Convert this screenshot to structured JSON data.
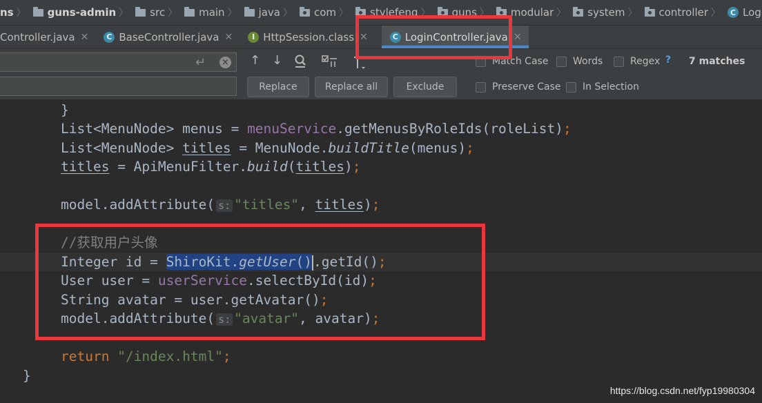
{
  "breadcrumb": {
    "items": [
      {
        "label": "ns",
        "type": "text"
      },
      {
        "label": "guns-admin",
        "type": "module"
      },
      {
        "label": "src",
        "type": "folder"
      },
      {
        "label": "main",
        "type": "folder"
      },
      {
        "label": "java",
        "type": "folder"
      },
      {
        "label": "com",
        "type": "package"
      },
      {
        "label": "stylefeng",
        "type": "package"
      },
      {
        "label": "guns",
        "type": "package"
      },
      {
        "label": "modular",
        "type": "package"
      },
      {
        "label": "system",
        "type": "package"
      },
      {
        "label": "controller",
        "type": "package"
      },
      {
        "label": "LoginController",
        "type": "class"
      }
    ]
  },
  "tabs": [
    {
      "label": "Controller.java",
      "icon": "none",
      "active": false
    },
    {
      "label": "BaseController.java",
      "icon": "class",
      "active": false
    },
    {
      "label": "HttpSession.class",
      "icon": "interface",
      "active": false
    },
    {
      "label": "LoginController.java",
      "icon": "class",
      "active": true
    }
  ],
  "find": {
    "search_value": "",
    "replace_value": "",
    "buttons": {
      "replace": "Replace",
      "replace_all": "Replace all",
      "exclude": "Exclude"
    },
    "options": {
      "match_case": "Match Case",
      "words": "Words",
      "regex": "Regex",
      "regex_help": "?",
      "preserve_case": "Preserve Case",
      "in_selection": "In Selection"
    },
    "matches": "7 matches"
  },
  "code": {
    "l1": "}",
    "l2_type": "List<MenuNode>",
    "l2_var": "menus",
    "l2_eq": " = ",
    "l2_field": "menuService",
    "l2_call": ".getMenusByRoleIds(roleList)",
    "l2_semi": ";",
    "l3_type": "List<MenuNode>",
    "l3_var": "titles",
    "l3_eq": " = MenuNode.",
    "l3_method": "buildTitle",
    "l3_args": "(menus)",
    "l3_semi": ";",
    "l4_var": "titles",
    "l4_eq": " = ApiMenuFilter.",
    "l4_method": "build",
    "l4_open": "(",
    "l4_arg": "titles",
    "l4_close": ")",
    "l4_semi": ";",
    "l5_call": "model.addAttribute(",
    "l5_hint": "s:",
    "l5_str": "\"titles\"",
    "l5_comma": ", ",
    "l5_arg": "titles",
    "l5_close": ")",
    "l5_semi": ";",
    "l6_comment": "//获取用户头像",
    "l7_decl": "Integer id = ",
    "l7_sel_cls": "ShiroKit.",
    "l7_sel_method": "getUser",
    "l7_sel_parens": "()",
    "l7_rest": ".getId()",
    "l7_semi": ";",
    "l8_decl": "User user = ",
    "l8_field": "userService",
    "l8_call": ".selectById(id)",
    "l8_semi": ";",
    "l9_decl": "String avatar = user.getAvatar()",
    "l9_semi": ";",
    "l10_call": "model.addAttribute(",
    "l10_hint": "s:",
    "l10_str": "\"avatar\"",
    "l10_rest": ", avatar)",
    "l10_semi": ";",
    "l11_kw": "return",
    "l11_str": "\"/index.html\"",
    "l11_semi": ";",
    "l12": "}"
  },
  "watermark": "https://blog.csdn.net/fyp19980304",
  "colors": {
    "annotation_red": "#e8383d",
    "selection": "#214283",
    "keyword": "#cc7832",
    "string": "#6a8759",
    "field": "#9876aa"
  }
}
